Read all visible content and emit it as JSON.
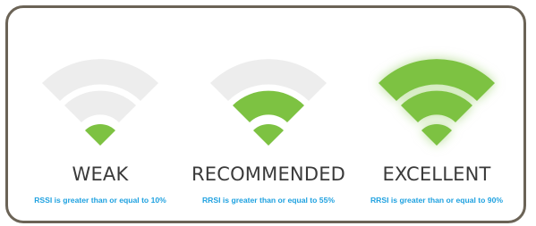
{
  "colors": {
    "active": "#7dc242",
    "inactive": "#ededed",
    "label": "#3a3a3a",
    "caption": "#1ea1e0",
    "border": "#6b6356"
  },
  "levels": [
    {
      "label": "WEAK",
      "caption": "RSSI is greater than or equal to 10%",
      "active_bars": 1,
      "glow": false
    },
    {
      "label": "RECOMMENDED",
      "caption": "RRSI is greater than or equal to 55%",
      "active_bars": 2,
      "glow": false
    },
    {
      "label": "EXCELLENT",
      "caption": "RRSI is greater than or equal to 90%",
      "active_bars": 3,
      "glow": true
    }
  ]
}
